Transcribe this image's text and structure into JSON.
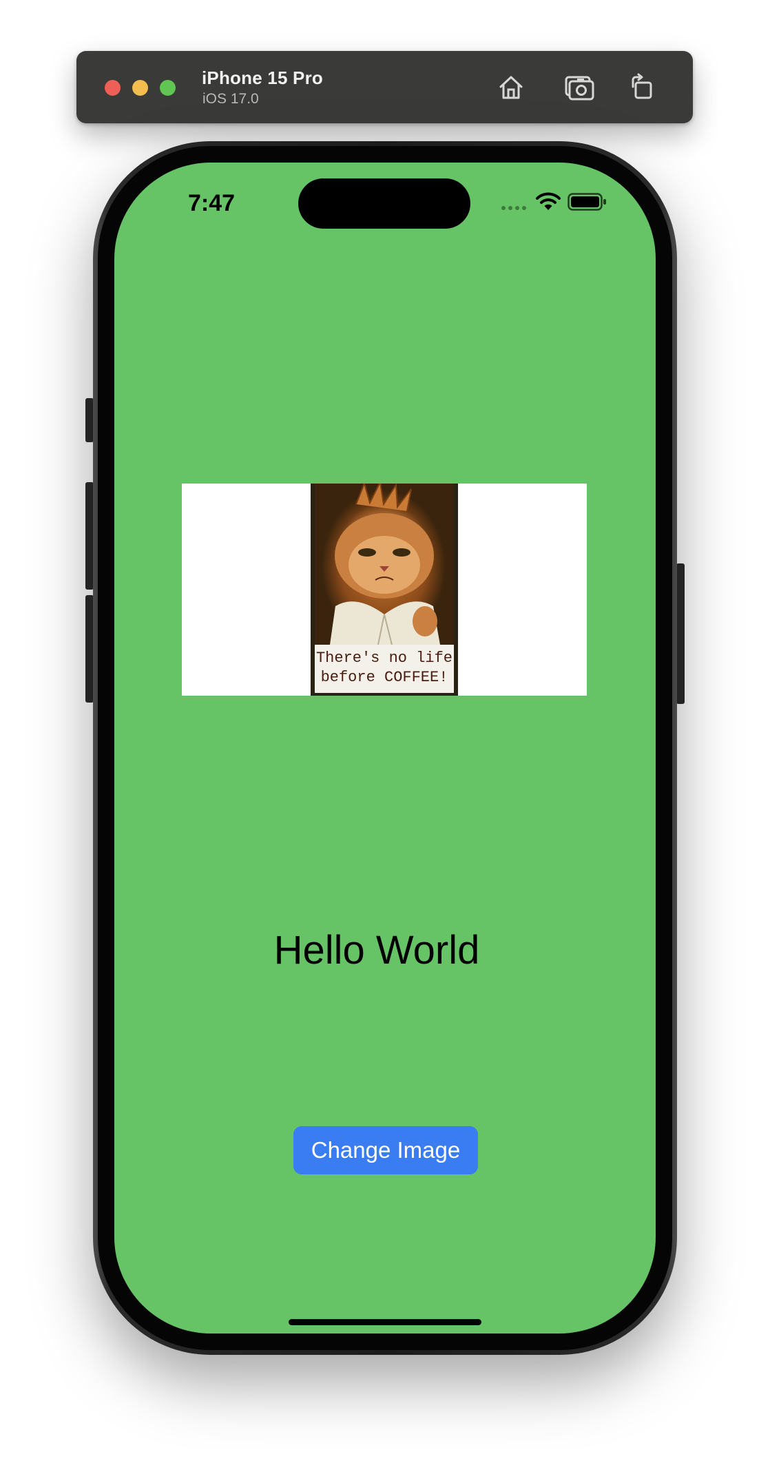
{
  "simulator": {
    "device_name": "iPhone 15 Pro",
    "os_version": "iOS 17.0",
    "toolbar_icons": [
      "home-icon",
      "screenshot-icon",
      "rotate-icon"
    ],
    "colors": {
      "bar": "#3a3a38",
      "close": "#ee5f57",
      "minimize": "#f4bd4f",
      "zoom": "#61c554"
    }
  },
  "status_bar": {
    "time": "7:47",
    "icons": [
      "cellular-signal-icon",
      "wifi-icon",
      "battery-icon"
    ]
  },
  "app": {
    "background_color": "#66c466",
    "image": {
      "caption_line1": "There's no life",
      "caption_line2": "before COFFEE!"
    },
    "label": "Hello World",
    "button": {
      "label": "Change Image",
      "color": "#3a7cf2"
    }
  }
}
